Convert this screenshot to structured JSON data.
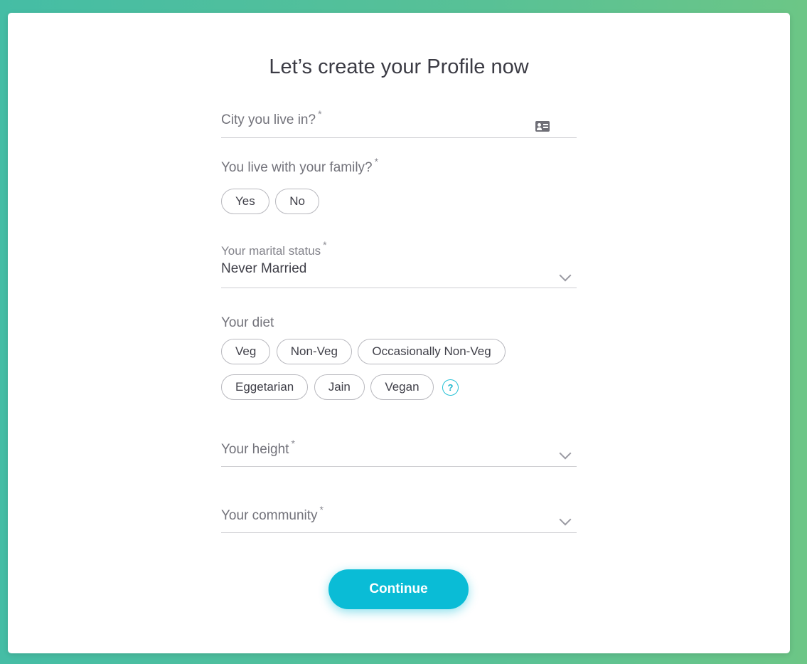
{
  "page": {
    "title": "Let’s create your Profile now"
  },
  "city": {
    "label": "City you live in?",
    "required_mark": "*",
    "icon": "id-card-icon"
  },
  "family": {
    "label": "You live with your family?",
    "required_mark": "*",
    "options": [
      "Yes",
      "No"
    ]
  },
  "marital": {
    "label": "Your marital status",
    "required_mark": "*",
    "value": "Never Married"
  },
  "diet": {
    "label": "Your diet",
    "options_row1": [
      "Veg",
      "Non-Veg",
      "Occasionally Non-Veg"
    ],
    "options_row2": [
      "Eggetarian",
      "Jain",
      "Vegan"
    ],
    "help": "?"
  },
  "height": {
    "label": "Your height",
    "required_mark": "*"
  },
  "community": {
    "label": "Your community",
    "required_mark": "*"
  },
  "actions": {
    "continue_label": "Continue"
  },
  "theme": {
    "accent": "#0abcd6",
    "background_from": "#45bda5",
    "background_to": "#6cc686"
  }
}
